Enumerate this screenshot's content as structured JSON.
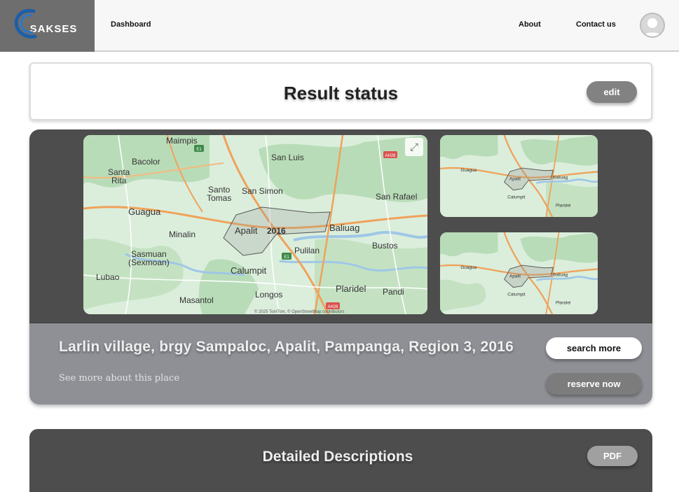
{
  "header": {
    "logo_text": "SAKSES",
    "nav": {
      "dashboard": "Dashboard",
      "about": "About",
      "contact": "Contact us"
    }
  },
  "status": {
    "title": "Result status",
    "edit_label": "edit"
  },
  "map": {
    "labels": {
      "maimpis": "Maimpis",
      "bacolor": "Bacolor",
      "santa_rita_1": "Santa",
      "santa_rita_2": "Rita",
      "san_luis": "San Luis",
      "santo_tomas_1": "Santo",
      "santo_tomas_2": "Tomas",
      "san_simon": "San Simon",
      "san_rafael": "San Rafael",
      "guagua": "Guagua",
      "minalin": "Minalin",
      "apalit": "Apalit",
      "year": "2016",
      "baliuag": "Baliuag",
      "pulilan": "Pulilan",
      "bustos": "Bustos",
      "sasmuan_1": "Sasmuan",
      "sasmuan_2": "(Sexmoan)",
      "lubao": "Lubao",
      "calumpit": "Calumpit",
      "longos": "Longos",
      "plaridel": "Plaridel",
      "pandi": "Pandi",
      "masantol": "Masantol",
      "shield_e1": "E1",
      "shield_ah26": "AH26",
      "attribution": "© 2025 TomTom, © OpenStreetMap contributors"
    },
    "colors": {
      "land": "#dbeedc",
      "green": "#b9dcb8",
      "road_major": "#f0a25a",
      "road_minor": "#ffffff",
      "water": "#9fc7e6"
    },
    "expand_icon": "expand-icon"
  },
  "place": {
    "address": "Larlin village, brgy Sampaloc, Apalit, Pampanga, Region 3, 2016",
    "see_more": "See more about this place",
    "search_label": "search more",
    "reserve_label": "reserve now"
  },
  "details": {
    "title": "Detailed Descriptions",
    "pdf_label": "PDF"
  }
}
